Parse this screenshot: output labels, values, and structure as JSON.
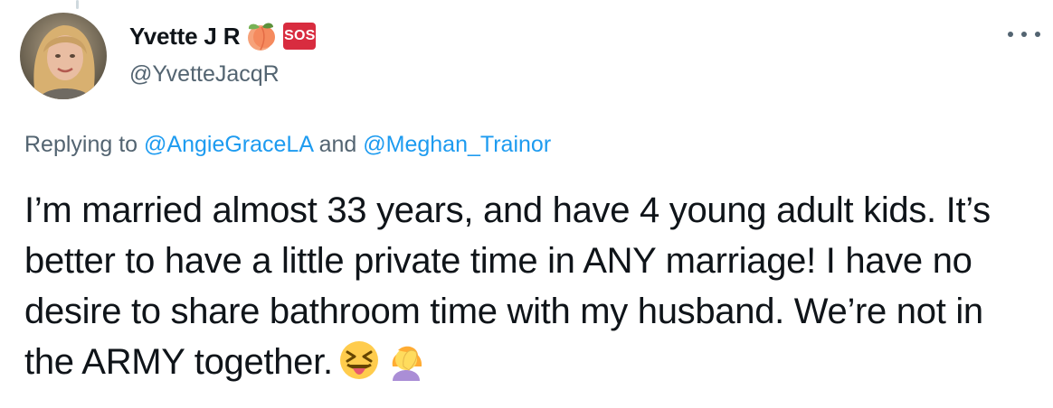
{
  "user": {
    "display_name": "Yvette J R",
    "handle": "@YvetteJacqR",
    "badges": [
      "peach-emoji-icon",
      "sos-badge"
    ],
    "sos_label": "SOS"
  },
  "reply": {
    "prefix": "Replying to",
    "mentions": [
      "@AngieGraceLA",
      "@Meghan_Trainor"
    ],
    "joiner": "and"
  },
  "tweet": {
    "text": "I’m married almost 33 years, and have 4 young adult kids. It’s better to have a little private time in ANY marriage! I have no desire to share bathroom time with my husband. We’re not in the ARMY together.",
    "emojis": [
      "squinting-tongue-face-icon",
      "woman-facepalming-icon"
    ]
  },
  "colors": {
    "text": "#0f1419",
    "secondary": "#536471",
    "link": "#1d9bf0",
    "sos": "#d82c3f"
  }
}
